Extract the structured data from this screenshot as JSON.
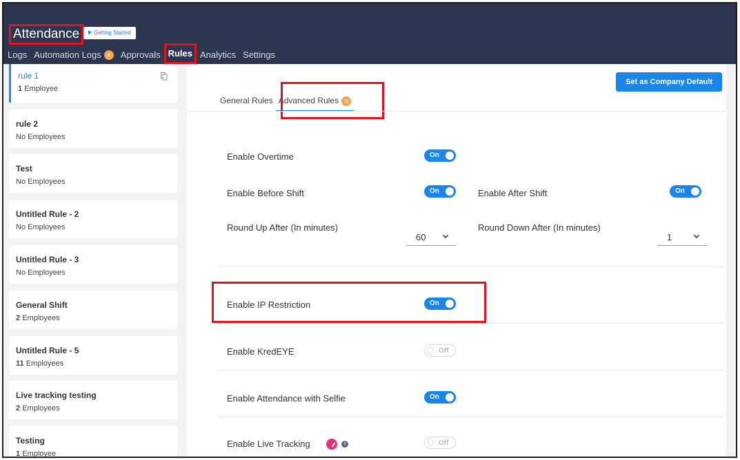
{
  "header": {
    "title": "Attendance",
    "getting_started": "Getting Started",
    "nav": [
      {
        "label": "Logs"
      },
      {
        "label": "Automation Logs"
      },
      {
        "label": "Approvals"
      },
      {
        "label": "Rules"
      },
      {
        "label": "Analytics"
      },
      {
        "label": "Settings"
      }
    ]
  },
  "sidebar": {
    "rules": [
      {
        "name": "rule 1",
        "count_num": "1",
        "count_text": "Employee"
      },
      {
        "name": "rule 2",
        "count_text": "No Employees"
      },
      {
        "name": "Test",
        "count_text": "No Employees"
      },
      {
        "name": "Untitled Rule - 2",
        "count_text": "No Employees"
      },
      {
        "name": "Untitled Rule - 3",
        "count_text": "No Employees"
      },
      {
        "name": "General Shift",
        "count_num": "2",
        "count_text": "Employees"
      },
      {
        "name": "Untitled Rule - 5",
        "count_num": "11",
        "count_text": "Employees"
      },
      {
        "name": "Live tracking testing",
        "count_num": "2",
        "count_text": "Employees"
      },
      {
        "name": "Testing",
        "count_num": "1",
        "count_text": "Employee"
      }
    ]
  },
  "main": {
    "company_default": "Set as Company Default",
    "tabs": [
      {
        "label": "General Rules"
      },
      {
        "label": "Advanced Rules"
      }
    ],
    "settings": {
      "overtime": {
        "label": "Enable Overtime",
        "state": "On"
      },
      "before_shift": {
        "label": "Enable Before Shift",
        "state": "On"
      },
      "after_shift": {
        "label": "Enable After Shift",
        "state": "On"
      },
      "round_up": {
        "label": "Round Up After (In minutes)",
        "value": "60"
      },
      "round_down": {
        "label": "Round Down After (In minutes)",
        "value": "1"
      },
      "ip_restriction": {
        "label": "Enable IP Restriction",
        "state": "On"
      },
      "kredeye": {
        "label": "Enable KredEYE",
        "state": "Off"
      },
      "selfie": {
        "label": "Enable Attendance with Selfie",
        "state": "On"
      },
      "live_tracking": {
        "label": "Enable Live Tracking",
        "state": "Off"
      }
    }
  },
  "colors": {
    "header_bg": "#2c3650",
    "accent": "#1a86ea",
    "highlight": "#e0141e",
    "badge": "#f0a54a",
    "pink": "#e6317a"
  }
}
